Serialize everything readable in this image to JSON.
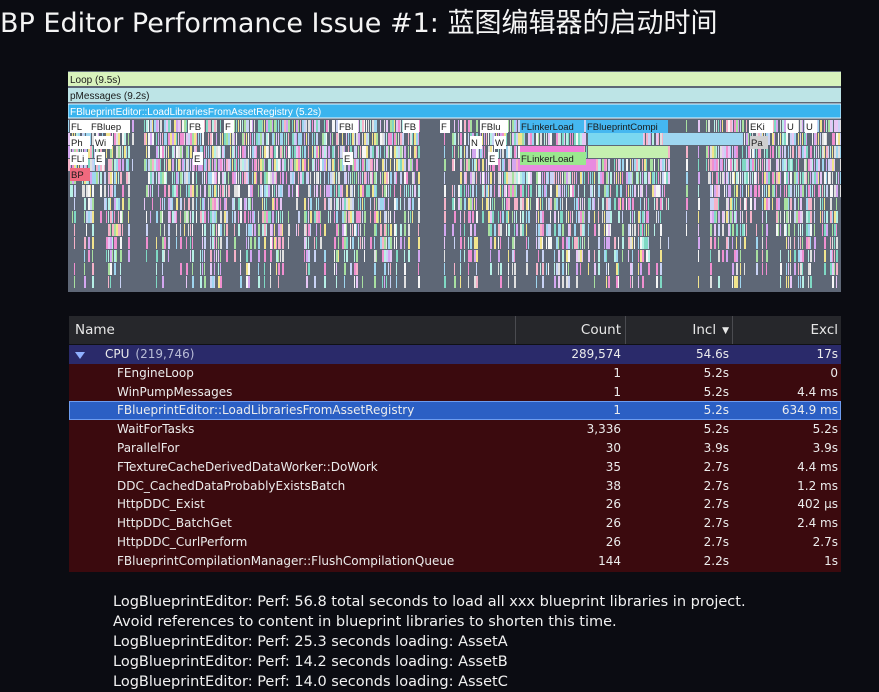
{
  "title": "BP Editor Performance Issue #1: 蓝图编辑器的启动时间",
  "timeline": {
    "bars": [
      {
        "label": "Loop (9.5s)"
      },
      {
        "label": "pMessages (9.2s)"
      },
      {
        "label": "FBlueprintEditor::LoadLibrariesFromAssetRegistry (5.2s)"
      }
    ],
    "small_labels": [
      "FL",
      "FBluep",
      "FB",
      "F",
      "FBl",
      "FB",
      "F",
      "FBlu",
      "FLinkerLoad",
      "FBlueprintCompi",
      "EKi",
      "U",
      "U",
      "Ph",
      "Wi",
      "N",
      "W",
      "Pa",
      "FLi",
      "E",
      "E",
      "E",
      "E",
      "FLinkerLoad",
      "BP"
    ],
    "colors": {
      "background": "#5e6776",
      "top_bar": "#d9f3bd",
      "message_bar": "#bde4e6",
      "selected_bar": "#3ab4ee"
    }
  },
  "table": {
    "headers": {
      "name": "Name",
      "count": "Count",
      "incl": "Incl",
      "excl": "Excl"
    },
    "sort_column": "Incl",
    "cpu_row": {
      "name": "CPU",
      "count_note": "(219,746)",
      "count": "289,574",
      "incl": "54.6s",
      "excl": "17s"
    },
    "rows": [
      {
        "name": "FEngineLoop",
        "count": "1",
        "incl": "5.2s",
        "excl": "0"
      },
      {
        "name": "WinPumpMessages",
        "count": "1",
        "incl": "5.2s",
        "excl": "4.4 ms"
      },
      {
        "name": "FBlueprintEditor::LoadLibrariesFromAssetRegistry",
        "count": "1",
        "incl": "5.2s",
        "excl": "634.9 ms",
        "selected": true
      },
      {
        "name": "WaitForTasks",
        "count": "3,336",
        "incl": "5.2s",
        "excl": "5.2s"
      },
      {
        "name": "ParallelFor",
        "count": "30",
        "incl": "3.9s",
        "excl": "3.9s"
      },
      {
        "name": "FTextureCacheDerivedDataWorker::DoWork",
        "count": "35",
        "incl": "2.7s",
        "excl": "4.4 ms"
      },
      {
        "name": "DDC_CachedDataProbablyExistsBatch",
        "count": "38",
        "incl": "2.7s",
        "excl": "1.2 ms"
      },
      {
        "name": "HttpDDC_Exist",
        "count": "26",
        "incl": "2.7s",
        "excl": "402 µs"
      },
      {
        "name": "HttpDDC_BatchGet",
        "count": "26",
        "incl": "2.7s",
        "excl": "2.4 ms"
      },
      {
        "name": "HttpDDC_CurlPerform",
        "count": "26",
        "incl": "2.7s",
        "excl": "2.7s"
      },
      {
        "name": "FBlueprintCompilationManager::FlushCompilationQueue",
        "count": "144",
        "incl": "2.2s",
        "excl": "1s"
      }
    ],
    "colors": {
      "row_bg": "#3b0a0e",
      "cpu_bg": "#2a2a6a",
      "selected_bg": "#2b5fc4",
      "header_bg": "#26272b"
    }
  },
  "log": [
    "LogBlueprintEditor: Perf: 56.8 total seconds to load all xxx blueprint libraries in project.",
    "Avoid references to content in blueprint libraries to shorten this time.",
    "LogBlueprintEditor: Perf: 25.3 seconds loading: AssetA",
    "LogBlueprintEditor: Perf: 14.2 seconds loading: AssetB",
    "LogBlueprintEditor: Perf: 14.0 seconds loading: AssetC"
  ]
}
